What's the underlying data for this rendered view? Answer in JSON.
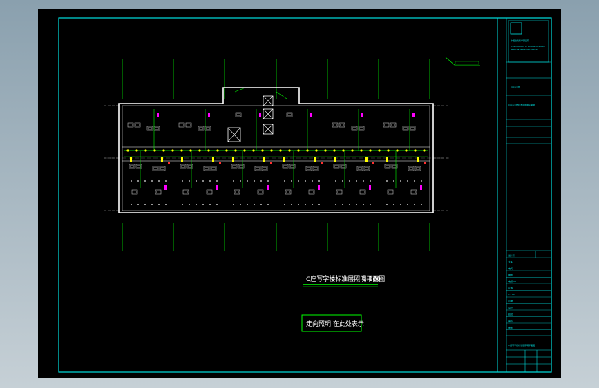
{
  "drawing": {
    "title": "C座写字楼标准层照明平面图",
    "scale": "1:100",
    "note": "走向照明 在此处表示"
  },
  "title_block": {
    "company_cn": "中国建筑科学研究院",
    "company_en_1": "CHINA ACADEMY OF BUILDING RESEARCH",
    "company_en_2": "INSTITUTE OF BUILDING DESIGN",
    "project_name": "C座写字楼",
    "sheet_name": "C座写字楼标准层照明平面图",
    "cells": [
      "设计号",
      "专业",
      "电气",
      "图号",
      "电施-03",
      "比例",
      "1:100",
      "日期",
      "设计",
      "校对",
      "审核",
      "审定"
    ]
  },
  "colors": {
    "frame": "#00e0e0",
    "wall": "#ffffff",
    "axis": "#00ff00",
    "circuit": "#00ff00",
    "fixture": "#ffff00",
    "furniture": "#c0c0c0",
    "magenta": "#ff00ff",
    "red": "#ff3030"
  }
}
